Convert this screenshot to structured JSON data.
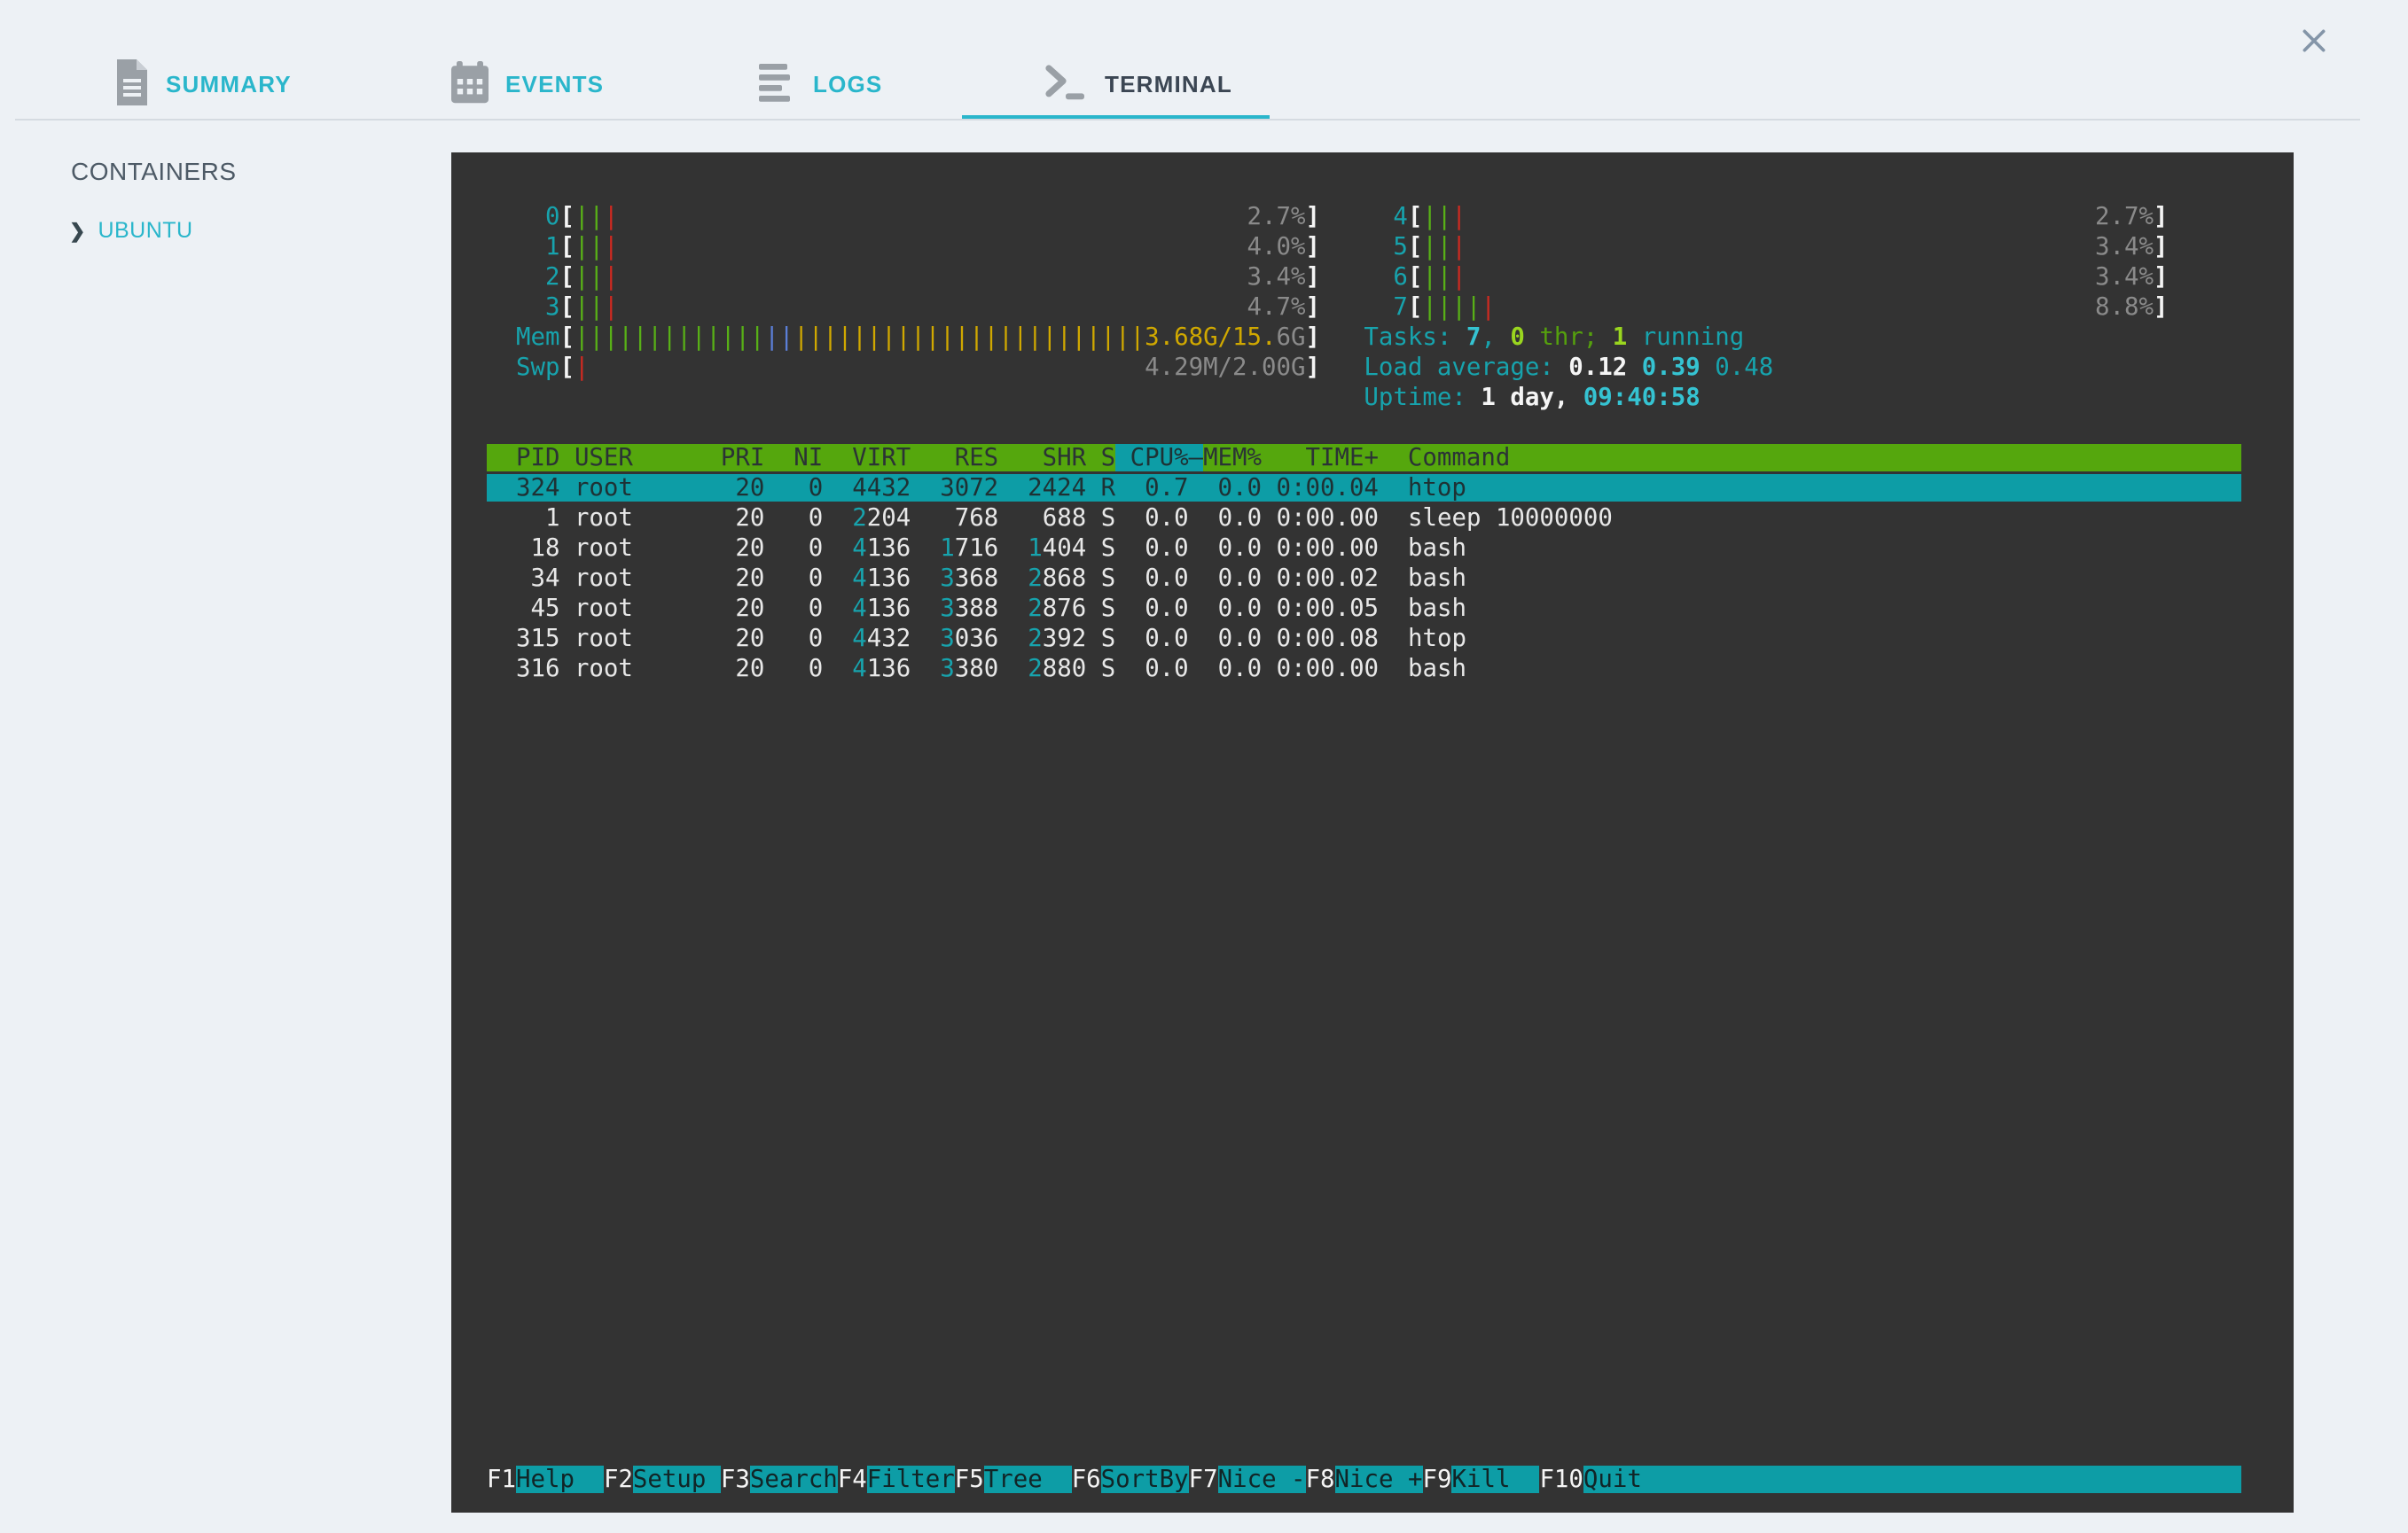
{
  "header": {
    "tabs": [
      {
        "id": "summary",
        "label": "SUMMARY",
        "active": false
      },
      {
        "id": "events",
        "label": "EVENTS",
        "active": false
      },
      {
        "id": "logs",
        "label": "LOGS",
        "active": false
      },
      {
        "id": "terminal",
        "label": "TERMINAL",
        "active": true
      }
    ]
  },
  "sidebar": {
    "heading": "CONTAINERS",
    "items": [
      {
        "label": "UBUNTU"
      }
    ]
  },
  "terminal": {
    "cpus_left": [
      {
        "id": "0",
        "green_bars": 2,
        "red_bars": 1,
        "pct": "2.7%"
      },
      {
        "id": "1",
        "green_bars": 2,
        "red_bars": 1,
        "pct": "4.0%"
      },
      {
        "id": "2",
        "green_bars": 2,
        "red_bars": 1,
        "pct": "3.4%"
      },
      {
        "id": "3",
        "green_bars": 2,
        "red_bars": 1,
        "pct": "4.7%"
      }
    ],
    "cpus_right": [
      {
        "id": "4",
        "green_bars": 2,
        "red_bars": 1,
        "pct": "2.7%"
      },
      {
        "id": "5",
        "green_bars": 2,
        "red_bars": 1,
        "pct": "3.4%"
      },
      {
        "id": "6",
        "green_bars": 2,
        "red_bars": 1,
        "pct": "3.4%"
      },
      {
        "id": "7",
        "green_bars": 4,
        "red_bars": 1,
        "pct": "8.8%"
      }
    ],
    "mem": {
      "label": "Mem",
      "green_bars": 13,
      "blue_bars": 2,
      "yellow_bars": 24,
      "value_bright": "3.68G/15.",
      "value_dim": "6G"
    },
    "swp": {
      "label": "Swp",
      "red_bars": 1,
      "value": "4.29M/2.00G"
    },
    "tasks": {
      "label": "Tasks:",
      "total": "7",
      "thr_count": "0",
      "thr_label": "thr;",
      "running_count": "1",
      "running_label": "running"
    },
    "load": {
      "label": "Load average:",
      "one": "0.12",
      "five": "0.39",
      "fifteen": "0.48"
    },
    "uptime": {
      "label": "Uptime:",
      "value_days": "1 day,",
      "value_time": "09:40:58"
    },
    "table": {
      "columns": [
        "PID",
        "USER",
        "PRI",
        "NI",
        "VIRT",
        "RES",
        "SHR",
        "S",
        "CPU%",
        "MEM%",
        "TIME+",
        "Command"
      ],
      "sort_column": "CPU%",
      "sort_indicator": "–",
      "rows": [
        {
          "pid": "324",
          "user": "root",
          "pri": "20",
          "ni": "0",
          "virt": "4432",
          "res": "3072",
          "shr": "2424",
          "s": "R",
          "cpu": "0.7",
          "mem": "0.0",
          "time": "0:00.04",
          "command": "htop",
          "selected": true
        },
        {
          "pid": "1",
          "user": "root",
          "pri": "20",
          "ni": "0",
          "virt": "2204",
          "res": "768",
          "shr": "688",
          "s": "S",
          "cpu": "0.0",
          "mem": "0.0",
          "time": "0:00.00",
          "command": "sleep 10000000",
          "selected": false
        },
        {
          "pid": "18",
          "user": "root",
          "pri": "20",
          "ni": "0",
          "virt": "4136",
          "res": "1716",
          "shr": "1404",
          "s": "S",
          "cpu": "0.0",
          "mem": "0.0",
          "time": "0:00.00",
          "command": "bash",
          "selected": false
        },
        {
          "pid": "34",
          "user": "root",
          "pri": "20",
          "ni": "0",
          "virt": "4136",
          "res": "3368",
          "shr": "2868",
          "s": "S",
          "cpu": "0.0",
          "mem": "0.0",
          "time": "0:00.02",
          "command": "bash",
          "selected": false
        },
        {
          "pid": "45",
          "user": "root",
          "pri": "20",
          "ni": "0",
          "virt": "4136",
          "res": "3388",
          "shr": "2876",
          "s": "S",
          "cpu": "0.0",
          "mem": "0.0",
          "time": "0:00.05",
          "command": "bash",
          "selected": false
        },
        {
          "pid": "315",
          "user": "root",
          "pri": "20",
          "ni": "0",
          "virt": "4432",
          "res": "3036",
          "shr": "2392",
          "s": "S",
          "cpu": "0.0",
          "mem": "0.0",
          "time": "0:00.08",
          "command": "htop",
          "selected": false
        },
        {
          "pid": "316",
          "user": "root",
          "pri": "20",
          "ni": "0",
          "virt": "4136",
          "res": "3380",
          "shr": "2880",
          "s": "S",
          "cpu": "0.0",
          "mem": "0.0",
          "time": "0:00.00",
          "command": "bash",
          "selected": false
        }
      ]
    },
    "fkeys": [
      {
        "key": "F1",
        "label": "Help"
      },
      {
        "key": "F2",
        "label": "Setup"
      },
      {
        "key": "F3",
        "label": "Search"
      },
      {
        "key": "F4",
        "label": "Filter"
      },
      {
        "key": "F5",
        "label": "Tree"
      },
      {
        "key": "F6",
        "label": "SortBy"
      },
      {
        "key": "F7",
        "label": "Nice -"
      },
      {
        "key": "F8",
        "label": "Nice +"
      },
      {
        "key": "F9",
        "label": "Kill"
      },
      {
        "key": "F10",
        "label": "Quit"
      }
    ],
    "colors": {
      "accent": "#2ab6cb",
      "terminal_bg": "#333333",
      "header_green": "#55a70d",
      "selection_teal": "#0d9da6",
      "bar_green": "#58b017",
      "bar_red": "#cc2a21",
      "bar_yellow": "#d0a800",
      "bar_blue": "#5b7fd8",
      "text_teal": "#17a3ad",
      "text_gray": "#8a8a8a"
    }
  }
}
